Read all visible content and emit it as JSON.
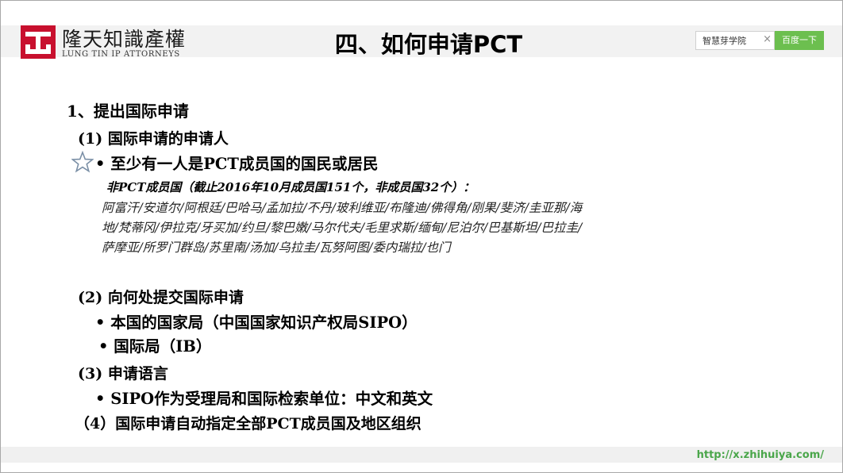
{
  "logo": {
    "cn": "隆天知識產權",
    "en": "LUNG TIN IP ATTORNEYS"
  },
  "title": "四、如何申请PCT",
  "search": {
    "value": "智慧芽学院",
    "button_label": "百度一下",
    "clear_icon": "×"
  },
  "content": {
    "heading": "1、提出国际申请",
    "sec1": {
      "label": "(1) 国际申请的申请人",
      "bullet": "• 至少有一人是PCT成员国的国民或居民",
      "note": "非PCT成员国（截止2016年10月成员国151个，非成员国32个）：",
      "countries": "阿富汗/安道尔/阿根廷/巴哈马/孟加拉/不丹/玻利维亚/布隆迪/佛得角/刚果/斐济/圭亚那/海地/梵蒂冈/伊拉克/牙买加/约旦/黎巴嫩/马尔代夫/毛里求斯/缅甸/尼泊尔/巴基斯坦/巴拉圭/萨摩亚/所罗门群岛/苏里南/汤加/乌拉圭/瓦努阿图/委内瑞拉/也门"
    },
    "sec2": {
      "label": "(2) 向何处提交国际申请",
      "bullet1": "• 本国的国家局（中国国家知识产权局SIPO）",
      "bullet2": "• 国际局（IB）"
    },
    "sec3": {
      "label": "(3) 申请语言",
      "bullet": "• SIPO作为受理局和国际检索单位：中文和英文"
    },
    "sec4": {
      "label": "（4）国际申请自动指定全部PCT成员国及地区组织"
    }
  },
  "footer": {
    "url": "http://x.zhihuiya.com/"
  },
  "colors": {
    "logo_red": "#c8102e",
    "search_button_green": "#6cbf4f",
    "footer_url_green": "#4aa64a",
    "star_outline": "#7a8fa6"
  }
}
